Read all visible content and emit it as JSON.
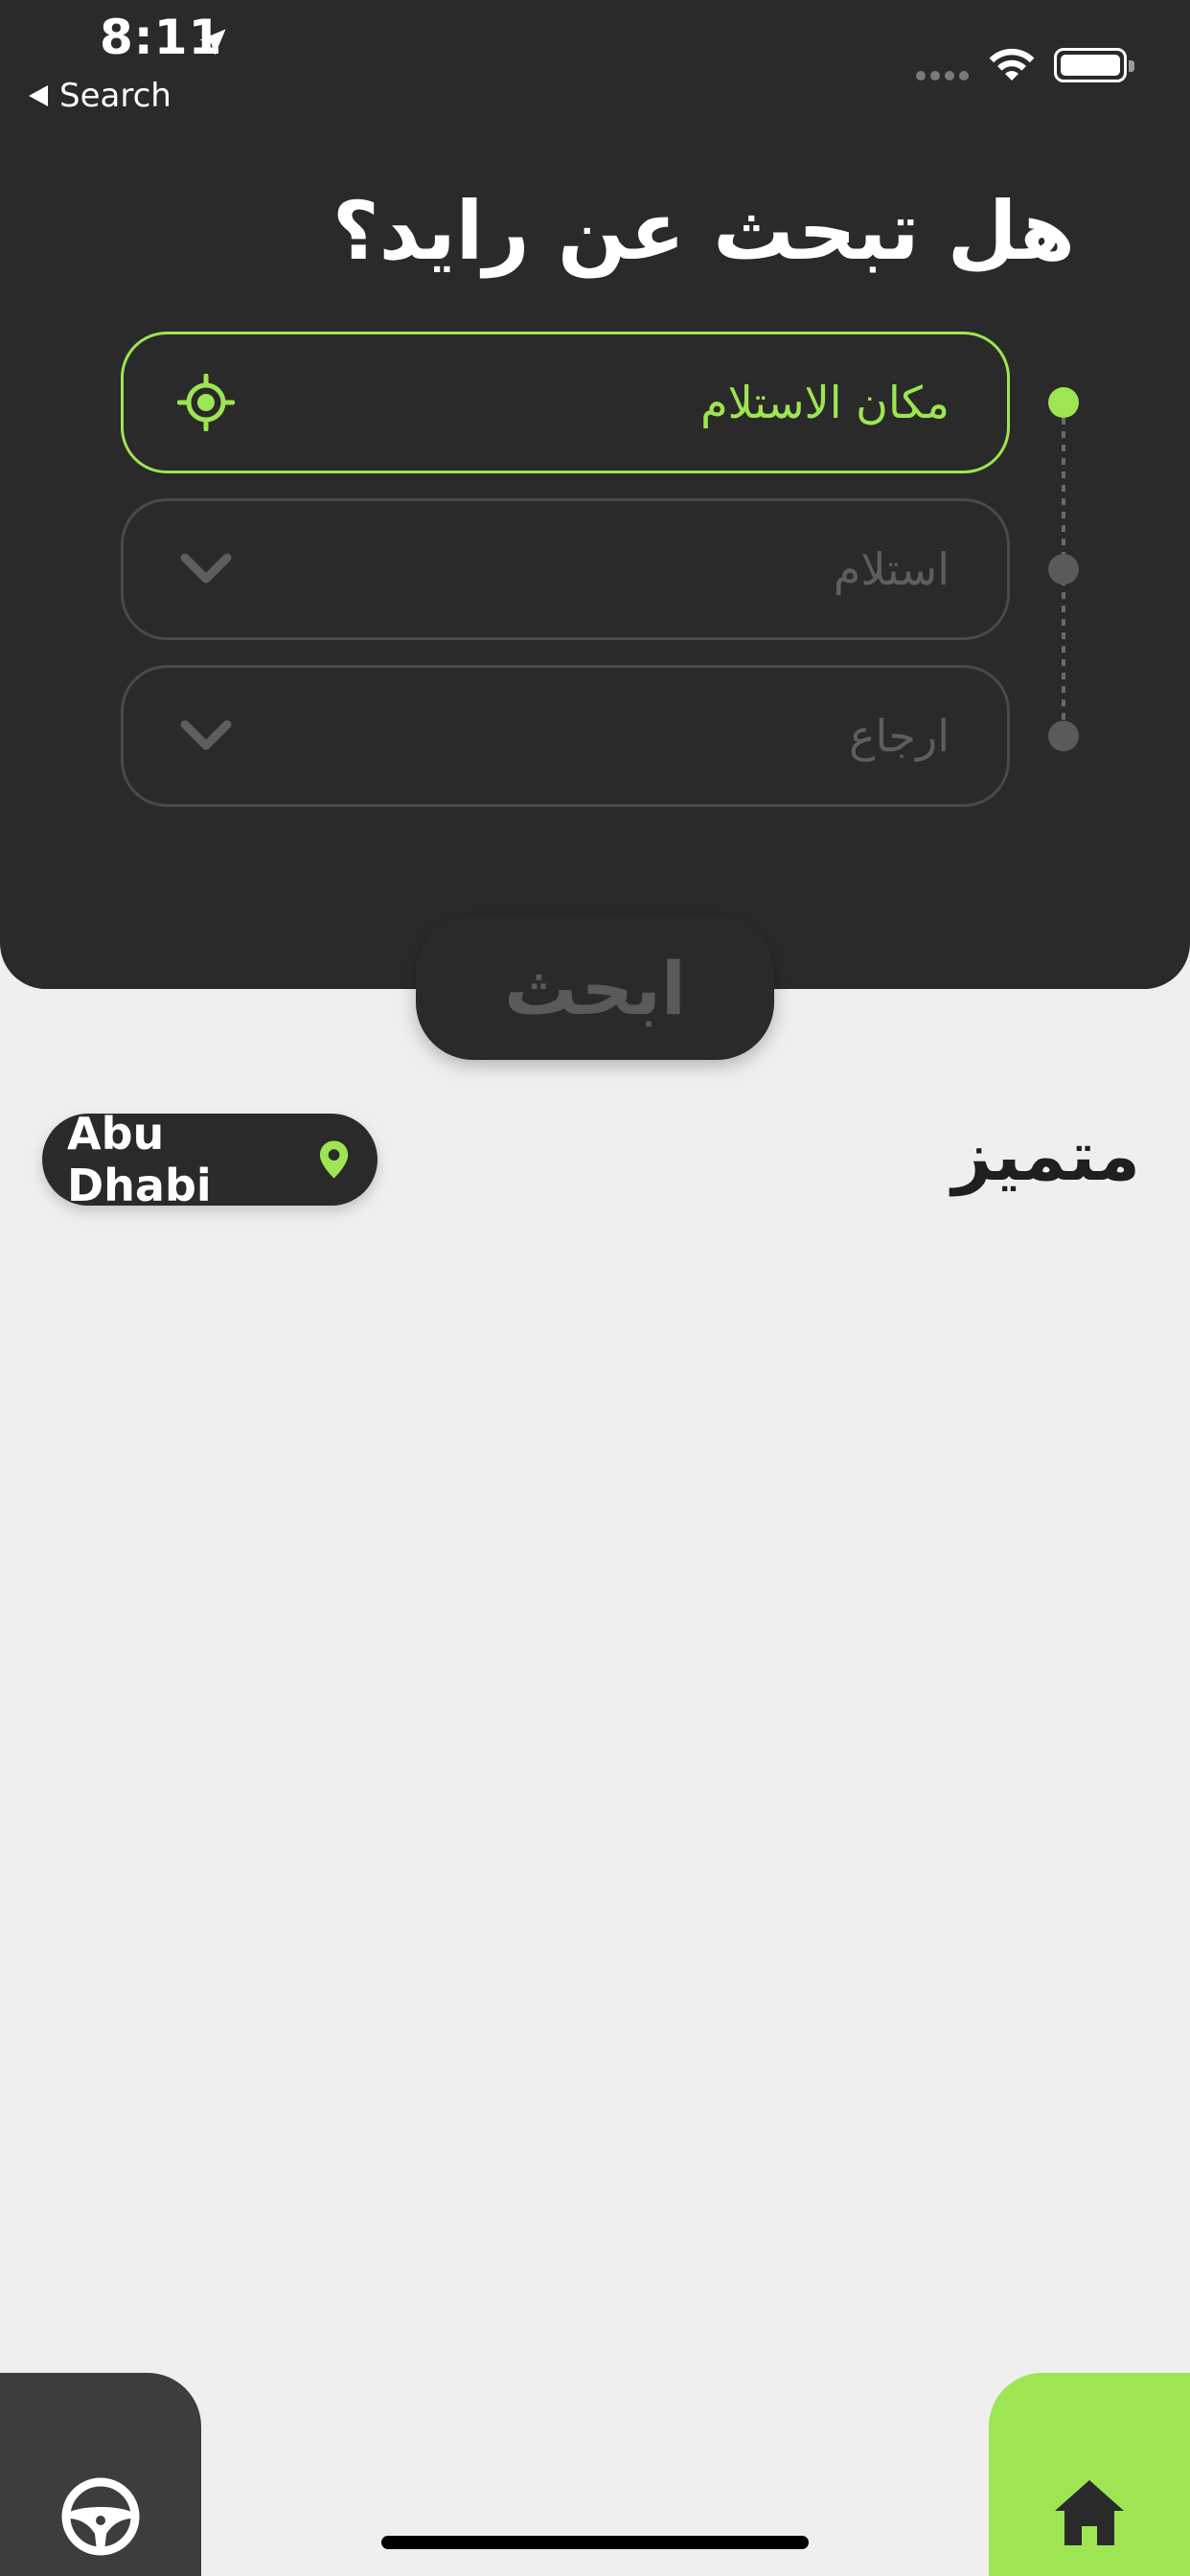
{
  "status_bar": {
    "time": "8:11",
    "back_label": "Search"
  },
  "header": {
    "title": "هل تبحث عن رايد؟"
  },
  "form": {
    "pickup_location": "مكان الاستلام",
    "pickup_date": "استلام",
    "return_date": "ارجاع"
  },
  "search_button": "ابحث",
  "featured": {
    "title": "متميز",
    "city": "Abu Dhabi"
  },
  "colors": {
    "accent": "#9de552",
    "panel": "#2a2a2a",
    "background": "#efefef"
  },
  "icons": {
    "location_target": "crosshair-icon",
    "dropdown": "chevron-down-icon",
    "city_pin": "map-pin-icon",
    "tab_left": "steering-wheel-icon",
    "tab_right": "home-icon"
  }
}
